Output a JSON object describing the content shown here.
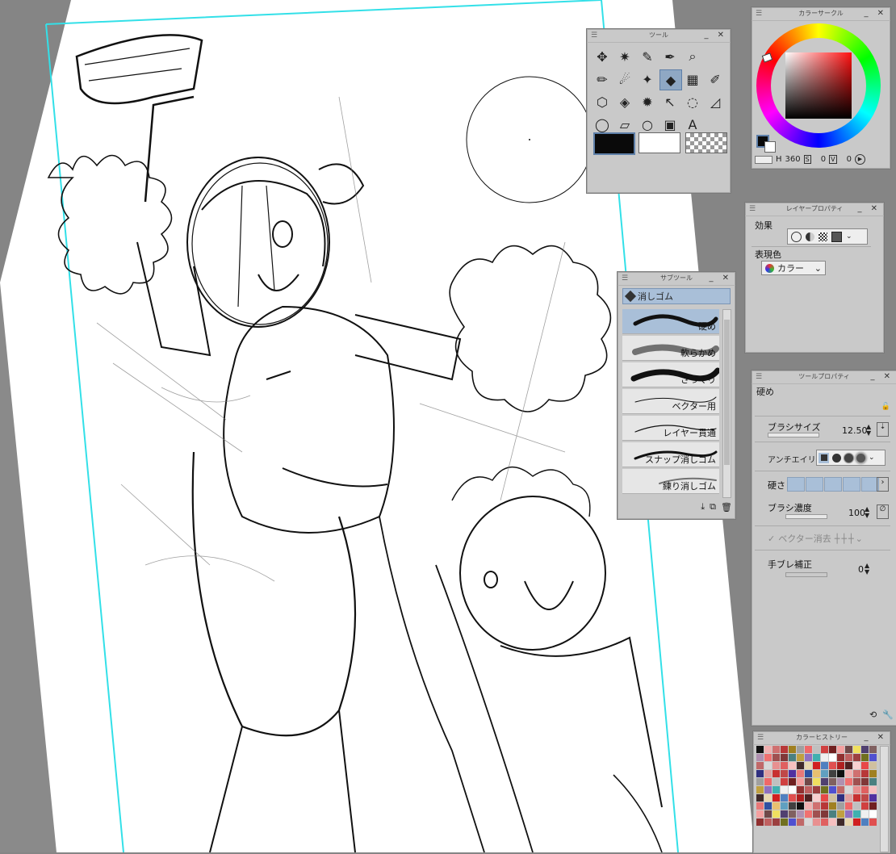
{
  "tool_panel": {
    "title": "ツール",
    "icons": [
      "move-icon",
      "auto-select-icon",
      "eyedropper-icon",
      "pen-icon",
      "zoom-icon",
      "pencil-icon",
      "blend-icon",
      "sparkle-icon",
      "eraser-icon",
      "frame-icon",
      "brush-icon",
      "3d-object-icon",
      "fill-icon",
      "burst-icon",
      "object-select-icon",
      "lasso-select-icon",
      "ruler-icon",
      "lasso-icon",
      "gradient-shape-icon",
      "ellipse-icon",
      "gradient-icon",
      "text-icon"
    ],
    "main_color": "#0a0a0a",
    "sub_color": "#ffffff"
  },
  "color_circle": {
    "title": "カラーサークル",
    "hue_value": "360",
    "s_value": "0",
    "v_value": "0",
    "s_label": "S",
    "v_label": "V",
    "accent": "#e02020"
  },
  "layer_property": {
    "title": "レイヤープロパティ",
    "effect_label": "効果",
    "expression_label": "表現色",
    "expression_value": "カラー"
  },
  "sub_tool": {
    "title": "サブツール",
    "group_name": "消しゴム",
    "brushes": [
      "硬め",
      "軟らかめ",
      "ざっくり",
      "ベクター用",
      "レイヤー貫通",
      "スナップ消しゴム",
      "練り消しゴム"
    ]
  },
  "tool_property": {
    "title": "ツールプロパティ",
    "preset_name": "硬め",
    "brush_size_label": "ブラシサイズ",
    "brush_size_value": "12.50",
    "antialias_label": "アンチエイリアス",
    "hardness_label": "硬さ",
    "density_label": "ブラシ濃度",
    "density_value": "100",
    "vector_erase_label": "ベクター消去",
    "stabilization_label": "手ブレ補正",
    "stabilization_value": "0"
  },
  "color_history": {
    "title": "カラーヒストリー",
    "colors": [
      "#101010",
      "#c83030",
      "#e05050",
      "#f07070",
      "#d04040",
      "#b02020",
      "#e89090",
      "#ffffff",
      "#f0b0b0",
      "#c04848",
      "#903030",
      "#a05050",
      "#702020",
      "#502020",
      "#e06060",
      "#f4a0a0",
      "#d07070",
      "#5030a0",
      "#c06060",
      "#803838",
      "#e87878",
      "#f8d0d0",
      "#f6c0c0",
      "#704848",
      "#b83838",
      "#402a2a",
      "#9c4040",
      "#4a8080",
      "#3050a0",
      "#e84848",
      "#c0a040",
      "#f0e060",
      "#a08020",
      "#e8d8b0",
      "#707020",
      "#a0a0a0",
      "#e8c070",
      "#d0c0a0",
      "#9070c0",
      "#504070",
      "#303080",
      "#d02020",
      "#5050d0",
      "#f06868",
      "#60a0c0",
      "#c06868",
      "#40b0b0",
      "#806060",
      "#e0a0a0",
      "#5080c0",
      "#b090b0",
      "#c0c0c0",
      "#404040",
      "#d8d8d8",
      "#f0f0f0"
    ]
  }
}
